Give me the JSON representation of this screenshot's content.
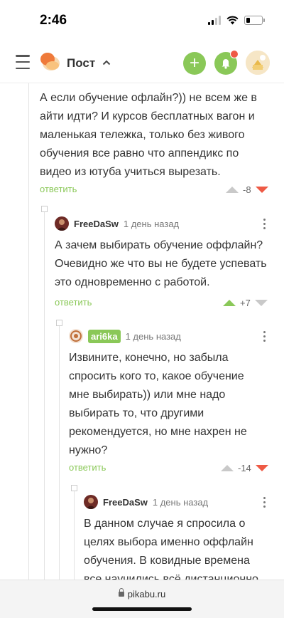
{
  "status_bar": {
    "time": "2:46"
  },
  "header": {
    "title": "Пост"
  },
  "comments": [
    {
      "text": "А если обучение офлайн?)) не всем же в айти идти? И курсов бесплатных вагон и маленькая тележка, только без живого обучения все равно что аппендикс по видео из ютуба учиться вырезать.",
      "reply": "ответить",
      "rating": "-8"
    },
    {
      "author": "FreeDaSw",
      "time": "1 день назад",
      "text": "А зачем выбирать обучение оффлайн? Очевидно же что вы не будете успевать это одновременно с работой.",
      "reply": "ответить",
      "rating": "+7"
    },
    {
      "author": "ari6ka",
      "time": "1 день назад",
      "text": "Извините, конечно, но забыла спросить кого то, какое обучение мне выбирать)) или мне надо выбирать то, что другими рекомендуется, но мне нахрен не нужно?",
      "reply": "ответить",
      "rating": "-14"
    },
    {
      "author": "FreeDaSw",
      "time": "1 день назад",
      "text": "В данном случае я спросила о целях выбора именно оффлайн обучения. В ковидные времена все научились всё дистанционно"
    }
  ],
  "browser": {
    "url": "pikabu.ru"
  },
  "colors": {
    "accent": "#8ac858",
    "downvote": "#ee5a45"
  }
}
